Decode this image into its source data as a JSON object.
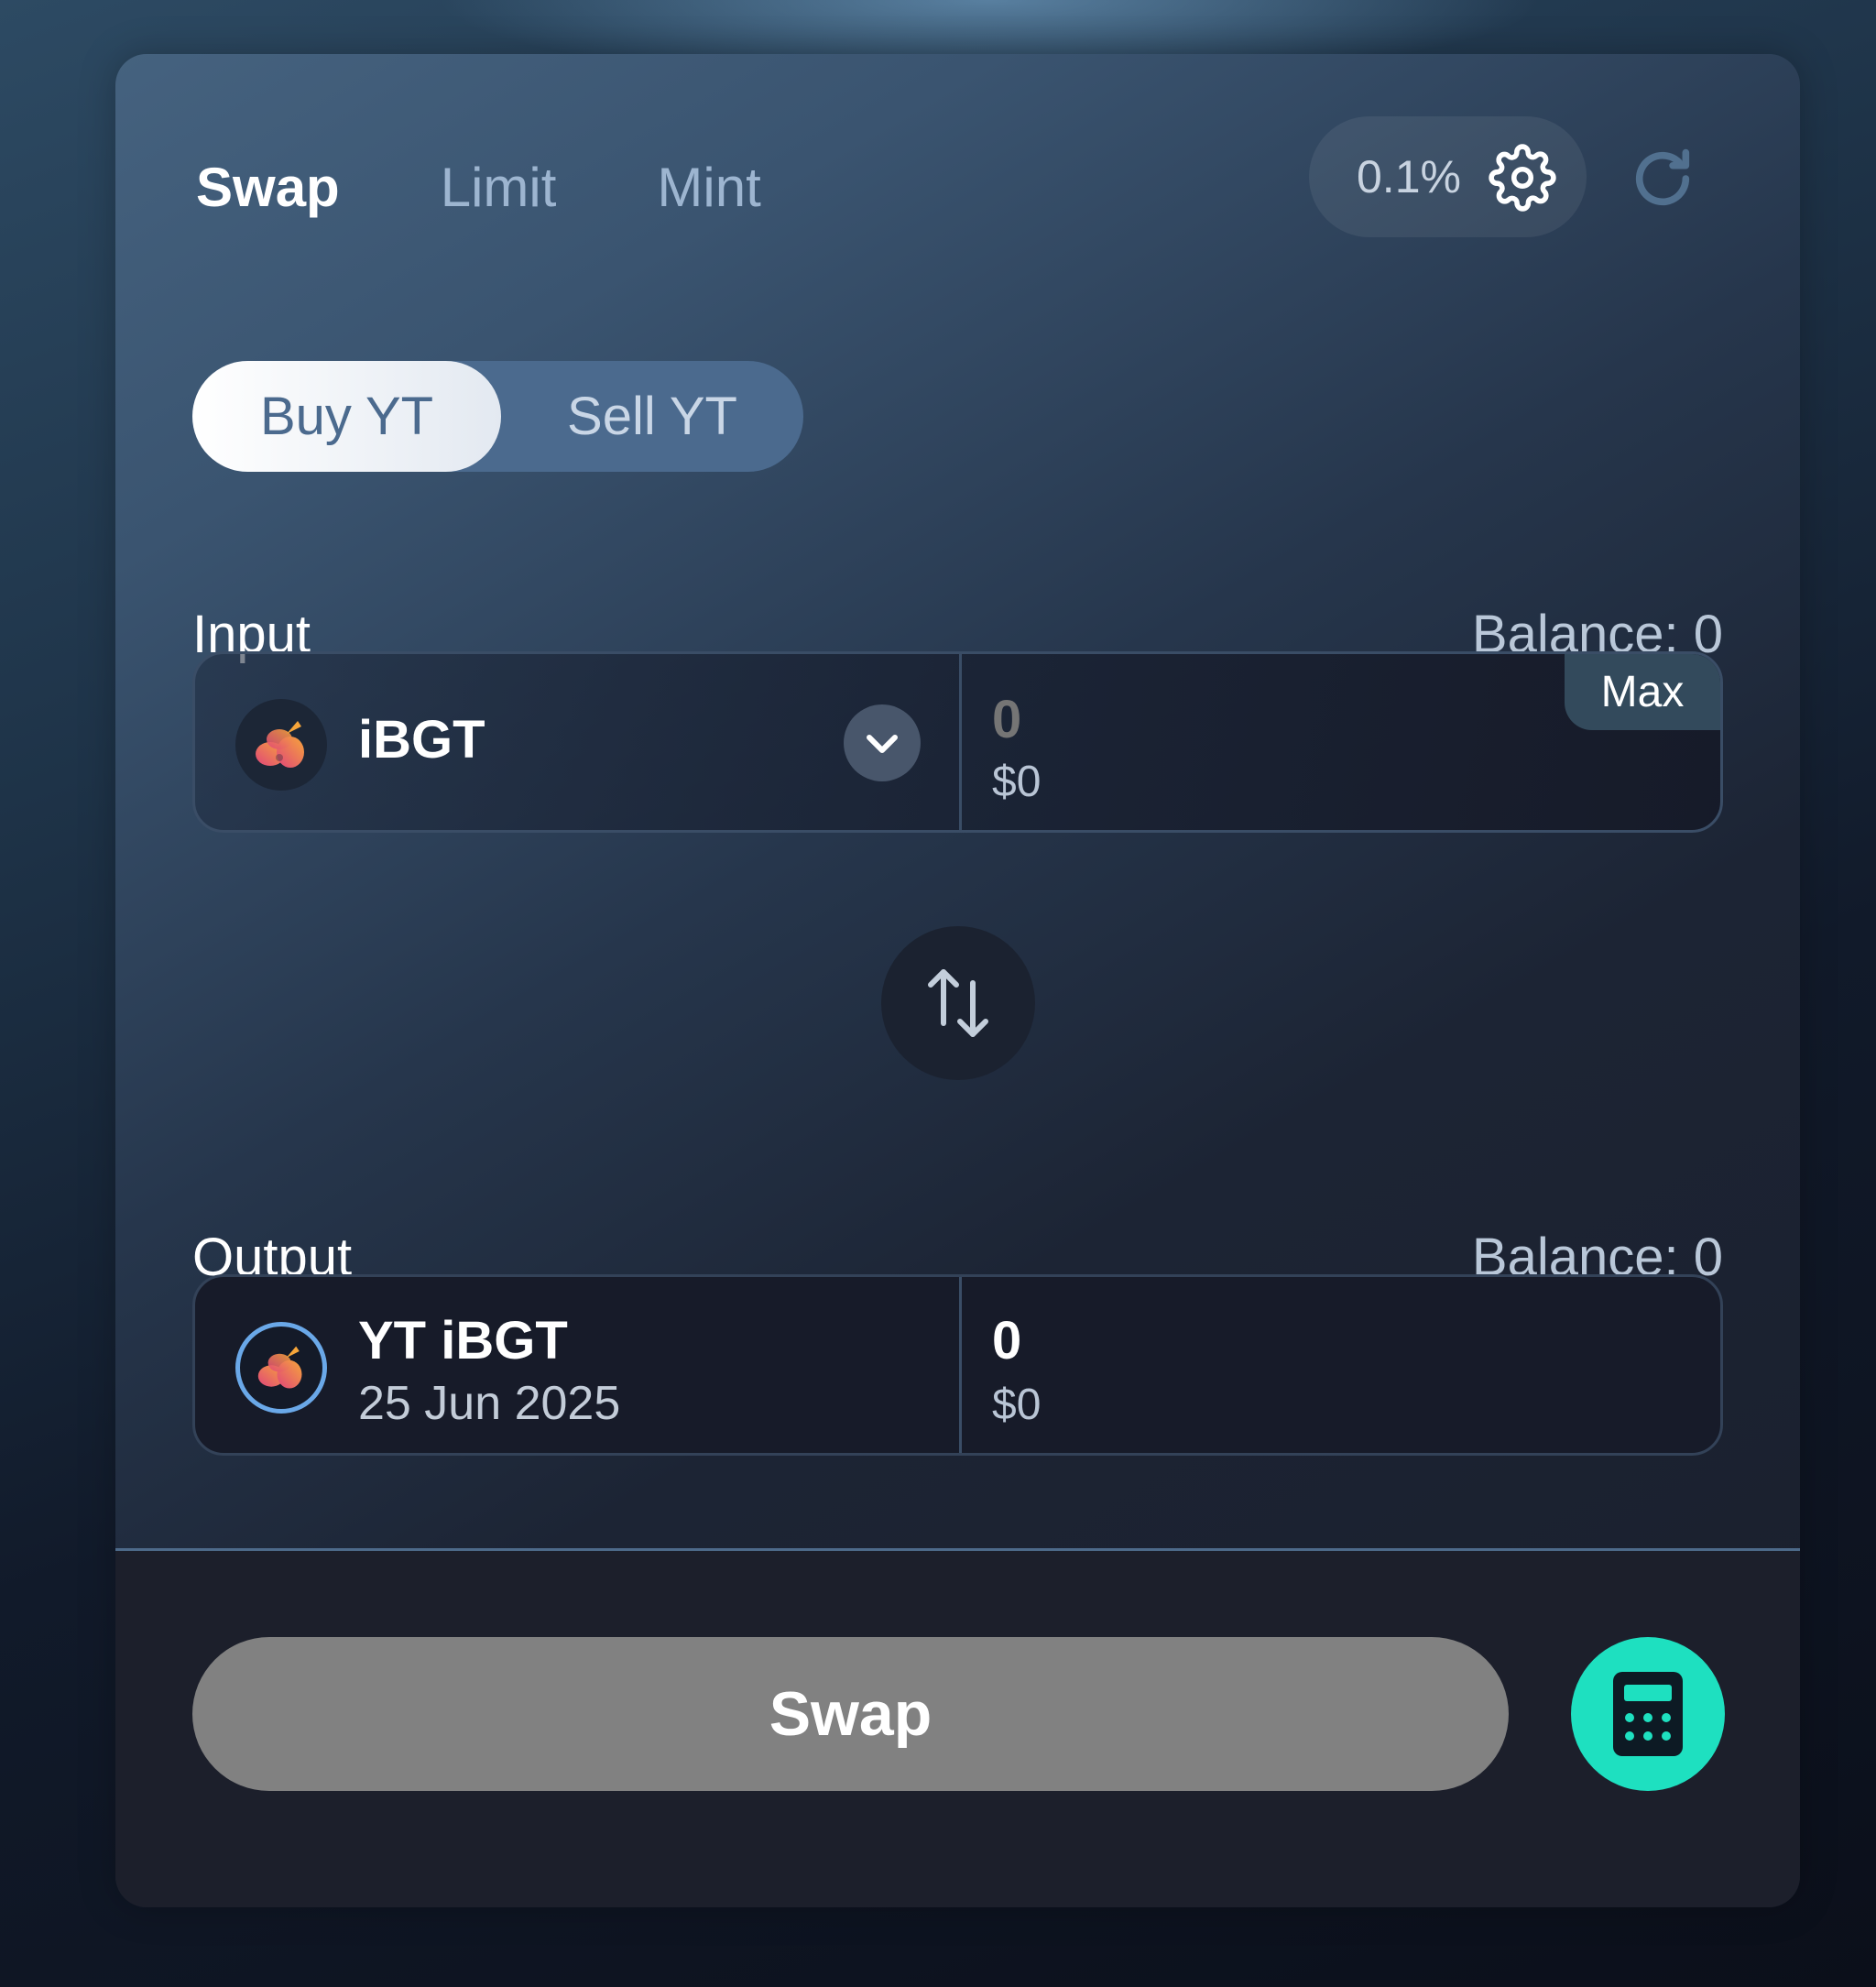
{
  "tabs": [
    {
      "label": "Swap",
      "active": true
    },
    {
      "label": "Limit",
      "active": false
    },
    {
      "label": "Mint",
      "active": false
    }
  ],
  "slippage": {
    "value": "0.1%",
    "icon": "gear-icon"
  },
  "refresh": {
    "icon": "refresh-icon"
  },
  "mode_toggle": {
    "buy_label": "Buy YT",
    "sell_label": "Sell YT",
    "selected": "Buy YT"
  },
  "input": {
    "label": "Input",
    "balance": "Balance: 0",
    "token": "iBGT",
    "amount": "0",
    "usd": "$0",
    "max_label": "Max"
  },
  "output": {
    "label": "Output",
    "balance": "Balance: 0",
    "token": "YT iBGT",
    "maturity": "25 Jun 2025",
    "amount": "0",
    "usd": "$0"
  },
  "actions": {
    "swap_label": "Swap",
    "calculator_icon": "calculator-icon"
  },
  "colors": {
    "accent": "#1ee0c0",
    "swap_disabled": "#818181",
    "toggle_bg": "#4b6a8e"
  }
}
